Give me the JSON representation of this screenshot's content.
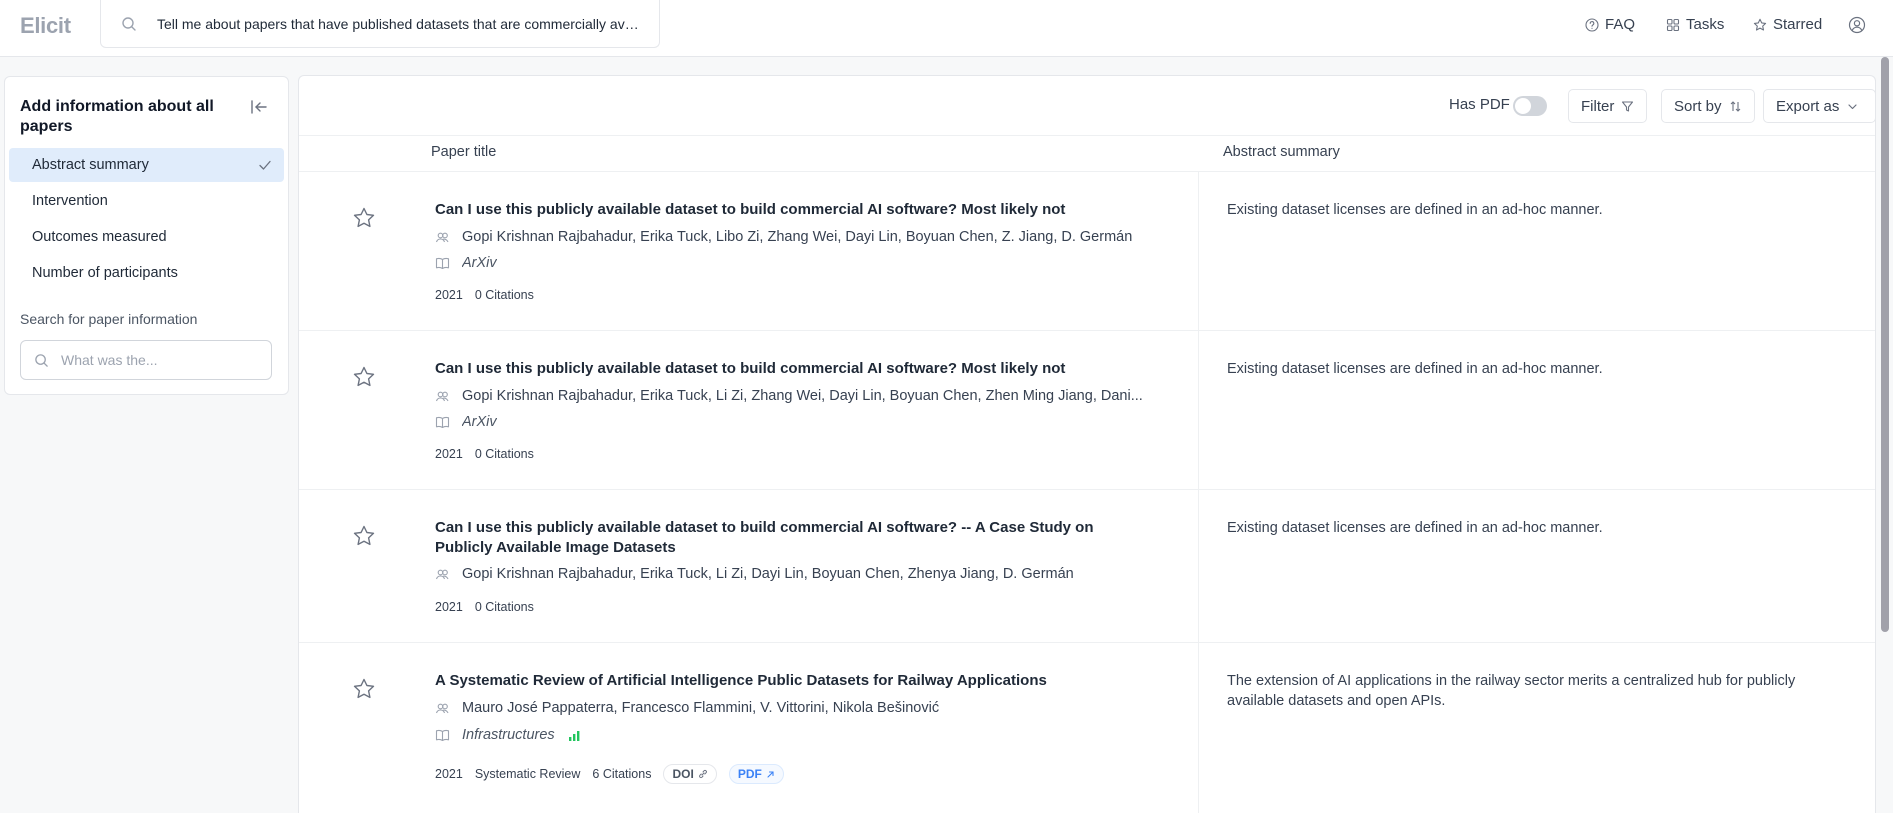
{
  "app": {
    "logo": "Elicit"
  },
  "search": {
    "query": "Tell me about papers that have published datasets that are commercially available"
  },
  "nav": {
    "faq": "FAQ",
    "tasks": "Tasks",
    "starred": "Starred"
  },
  "sidebar": {
    "title": "Add information about all papers",
    "columns": [
      {
        "label": "Abstract summary",
        "active": true
      },
      {
        "label": "Intervention",
        "active": false
      },
      {
        "label": "Outcomes measured",
        "active": false
      },
      {
        "label": "Number of participants",
        "active": false
      }
    ],
    "search_label": "Search for paper information",
    "search_placeholder": "What was the..."
  },
  "toolbar": {
    "has_pdf_label": "Has PDF",
    "has_pdf_on": false,
    "filter_label": "Filter",
    "sort_label": "Sort by",
    "export_label": "Export as"
  },
  "table": {
    "headers": {
      "title": "Paper title",
      "abstract": "Abstract summary"
    },
    "rows": [
      {
        "title": "Can I use this publicly available dataset to build commercial AI software? Most likely not",
        "authors": "Gopi Krishnan Rajbahadur, Erika Tuck, Libo Zi, Zhang Wei, Dayi Lin, Boyuan Chen, Z. Jiang, D. Germán",
        "journal": "ArXiv",
        "year": "2021",
        "citations": "0 Citations",
        "abstract": "Existing dataset licenses are defined in an ad-hoc manner."
      },
      {
        "title": "Can I use this publicly available dataset to build commercial AI software? Most likely not",
        "authors": "Gopi Krishnan Rajbahadur, Erika Tuck, Li Zi, Zhang Wei, Dayi Lin, Boyuan Chen, Zhen Ming Jiang, Dani...",
        "journal": "ArXiv",
        "year": "2021",
        "citations": "0 Citations",
        "abstract": "Existing dataset licenses are defined in an ad-hoc manner."
      },
      {
        "title": "Can I use this publicly available dataset to build commercial AI software? -- A Case Study on Publicly Available Image Datasets",
        "authors": "Gopi Krishnan Rajbahadur, Erika Tuck, Li Zi, Dayi Lin, Boyuan Chen, Zhenya Jiang, D. Germán",
        "year": "2021",
        "citations": "0 Citations",
        "abstract": "Existing dataset licenses are defined in an ad-hoc manner."
      },
      {
        "title": "A Systematic Review of Artificial Intelligence Public Datasets for Railway Applications",
        "authors": "Mauro José Pappaterra, Francesco Flammini, V. Vittorini, Nikola Bešinović",
        "journal": "Infrastructures",
        "year": "2021",
        "study_type": "Systematic Review",
        "citations": "6 Citations",
        "doi_label": "DOI",
        "pdf_label": "PDF",
        "abstract": "The extension of AI applications in the railway sector merits a centralized hub for publicly available datasets and open APIs."
      }
    ]
  },
  "colors": {
    "accent": "#3b82f6",
    "active_bg": "#e0ecfb",
    "quality_green": "#22c55e"
  }
}
